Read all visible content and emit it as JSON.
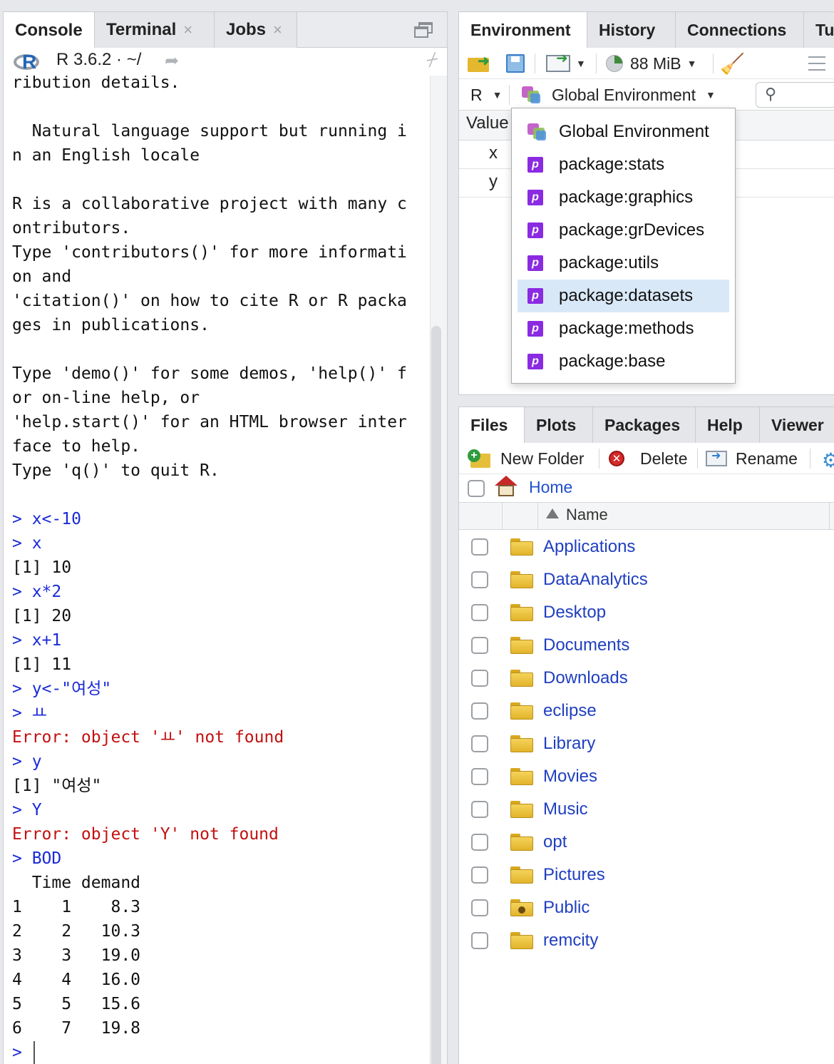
{
  "left_pane": {
    "tabs": [
      {
        "label": "Console",
        "closable": false
      },
      {
        "label": "Terminal",
        "closable": true
      },
      {
        "label": "Jobs",
        "closable": true
      }
    ],
    "close_glyph": "×",
    "r_version": "R 3.6.2 · ~/",
    "console_lines": [
      {
        "type": "out",
        "text": "ribution details."
      },
      {
        "type": "out",
        "text": ""
      },
      {
        "type": "out",
        "text": "  Natural language support but running i"
      },
      {
        "type": "out",
        "text": "n an English locale"
      },
      {
        "type": "out",
        "text": ""
      },
      {
        "type": "out",
        "text": "R is a collaborative project with many c"
      },
      {
        "type": "out",
        "text": "ontributors."
      },
      {
        "type": "out",
        "text": "Type 'contributors()' for more informati"
      },
      {
        "type": "out",
        "text": "on and"
      },
      {
        "type": "out",
        "text": "'citation()' on how to cite R or R packa"
      },
      {
        "type": "out",
        "text": "ges in publications."
      },
      {
        "type": "out",
        "text": ""
      },
      {
        "type": "out",
        "text": "Type 'demo()' for some demos, 'help()' f"
      },
      {
        "type": "out",
        "text": "or on-line help, or"
      },
      {
        "type": "out",
        "text": "'help.start()' for an HTML browser inter"
      },
      {
        "type": "out",
        "text": "face to help."
      },
      {
        "type": "out",
        "text": "Type 'q()' to quit R."
      },
      {
        "type": "out",
        "text": ""
      },
      {
        "type": "prompt",
        "text": "> x<-10"
      },
      {
        "type": "prompt",
        "text": "> x"
      },
      {
        "type": "out",
        "text": "[1] 10"
      },
      {
        "type": "prompt",
        "text": "> x*2"
      },
      {
        "type": "out",
        "text": "[1] 20"
      },
      {
        "type": "prompt",
        "text": "> x+1"
      },
      {
        "type": "out",
        "text": "[1] 11"
      },
      {
        "type": "prompt",
        "text": "> y<-\"여성\""
      },
      {
        "type": "prompt",
        "text": "> ㅛ"
      },
      {
        "type": "err",
        "text": "Error: object 'ㅛ' not found"
      },
      {
        "type": "prompt",
        "text": "> y"
      },
      {
        "type": "out",
        "text": "[1] \"여성\""
      },
      {
        "type": "prompt",
        "text": "> Y"
      },
      {
        "type": "err",
        "text": "Error: object 'Y' not found"
      },
      {
        "type": "prompt",
        "text": "> BOD"
      },
      {
        "type": "out",
        "text": "  Time demand"
      },
      {
        "type": "out",
        "text": "1    1    8.3"
      },
      {
        "type": "out",
        "text": "2    2   10.3"
      },
      {
        "type": "out",
        "text": "3    3   19.0"
      },
      {
        "type": "out",
        "text": "4    4   16.0"
      },
      {
        "type": "out",
        "text": "5    5   15.6"
      },
      {
        "type": "out",
        "text": "6    7   19.8"
      },
      {
        "type": "prompt",
        "text": ">"
      }
    ]
  },
  "env_pane": {
    "tabs": [
      "Environment",
      "History",
      "Connections",
      "Tu"
    ],
    "memory": "88 MiB",
    "language": "R",
    "environment_selector": "Global Environment",
    "table_header": "Value",
    "rows": [
      "x",
      "y"
    ],
    "dropdown": {
      "items": [
        {
          "label": "Global Environment",
          "icon": "global-env-icon",
          "selected": false
        },
        {
          "label": "package:stats",
          "icon": "package-icon",
          "selected": false
        },
        {
          "label": "package:graphics",
          "icon": "package-icon",
          "selected": false
        },
        {
          "label": "package:grDevices",
          "icon": "package-icon",
          "selected": false
        },
        {
          "label": "package:utils",
          "icon": "package-icon",
          "selected": false
        },
        {
          "label": "package:datasets",
          "icon": "package-icon",
          "selected": true
        },
        {
          "label": "package:methods",
          "icon": "package-icon",
          "selected": false
        },
        {
          "label": "package:base",
          "icon": "package-icon",
          "selected": false
        }
      ],
      "package_glyph": "p"
    }
  },
  "files_pane": {
    "tabs": [
      "Files",
      "Plots",
      "Packages",
      "Help",
      "Viewer"
    ],
    "toolbar": {
      "new_folder": "New Folder",
      "delete": "Delete",
      "rename": "Rename"
    },
    "breadcrumb": "Home",
    "column_name": "Name",
    "folders": [
      {
        "name": "Applications",
        "special": false
      },
      {
        "name": "DataAnalytics",
        "special": false
      },
      {
        "name": "Desktop",
        "special": false
      },
      {
        "name": "Documents",
        "special": false
      },
      {
        "name": "Downloads",
        "special": false
      },
      {
        "name": "eclipse",
        "special": false
      },
      {
        "name": "Library",
        "special": false
      },
      {
        "name": "Movies",
        "special": false
      },
      {
        "name": "Music",
        "special": false
      },
      {
        "name": "opt",
        "special": false
      },
      {
        "name": "Pictures",
        "special": false
      },
      {
        "name": "Public",
        "special": true
      },
      {
        "name": "remcity",
        "special": false
      }
    ]
  },
  "colors": {
    "prompt": "#1a2ad8",
    "error": "#c21010",
    "link": "#1f3fbf",
    "selection": "#d9e8f7",
    "package_icon": "#8a2be2"
  }
}
